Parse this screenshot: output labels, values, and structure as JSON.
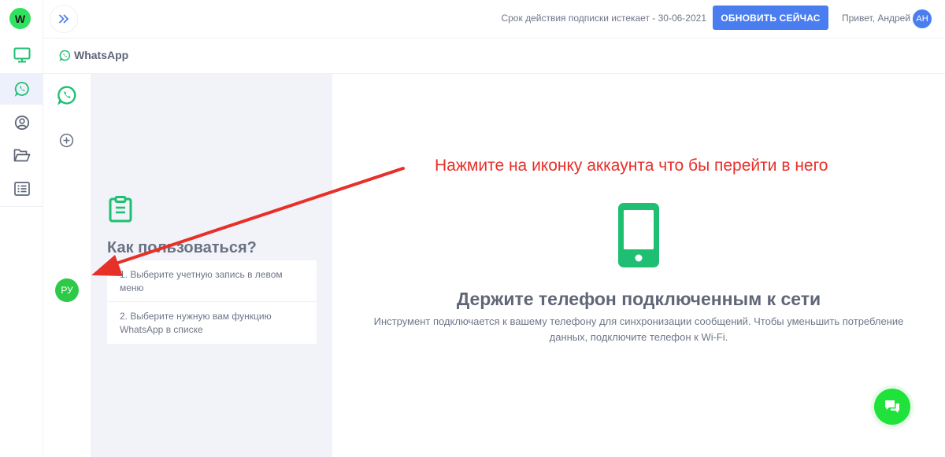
{
  "app": {
    "logo_letter": "W"
  },
  "topbar": {
    "subscription_text": "Срок действия подписки истекает - 30-06-2021",
    "upgrade_label": "ОБНОВИТЬ СЕЙЧАС",
    "greeting": "Привет, Андрей",
    "avatar_initials": "АН"
  },
  "sidebar": {
    "items": [
      {
        "icon": "monitor-icon"
      },
      {
        "icon": "whatsapp-icon",
        "active": true
      },
      {
        "icon": "user-circle-icon"
      },
      {
        "icon": "folder-open-icon"
      },
      {
        "icon": "list-icon"
      }
    ]
  },
  "subheader": {
    "title": "WhatsApp"
  },
  "accounts": {
    "ru_label": "РУ"
  },
  "howto": {
    "title": "Как пользоваться?",
    "steps": [
      "1. Выберите учетную запись в левом меню",
      "2. Выберите нужную вам функцию WhatsApp в списке"
    ]
  },
  "main": {
    "title": "Держите телефон подключенным к сети",
    "description": "Инструмент подключается к вашему телефону для синхронизации сообщений. Чтобы уменьшить потребление данных, подключите телефон к Wi-Fi."
  },
  "annotation": {
    "text": "Нажмите на иконку аккаунта что бы перейти в него",
    "color": "#e8302a"
  },
  "colors": {
    "accent": "#4a7ef0",
    "green": "#2fc94a",
    "brand_green": "#1fbf73"
  }
}
